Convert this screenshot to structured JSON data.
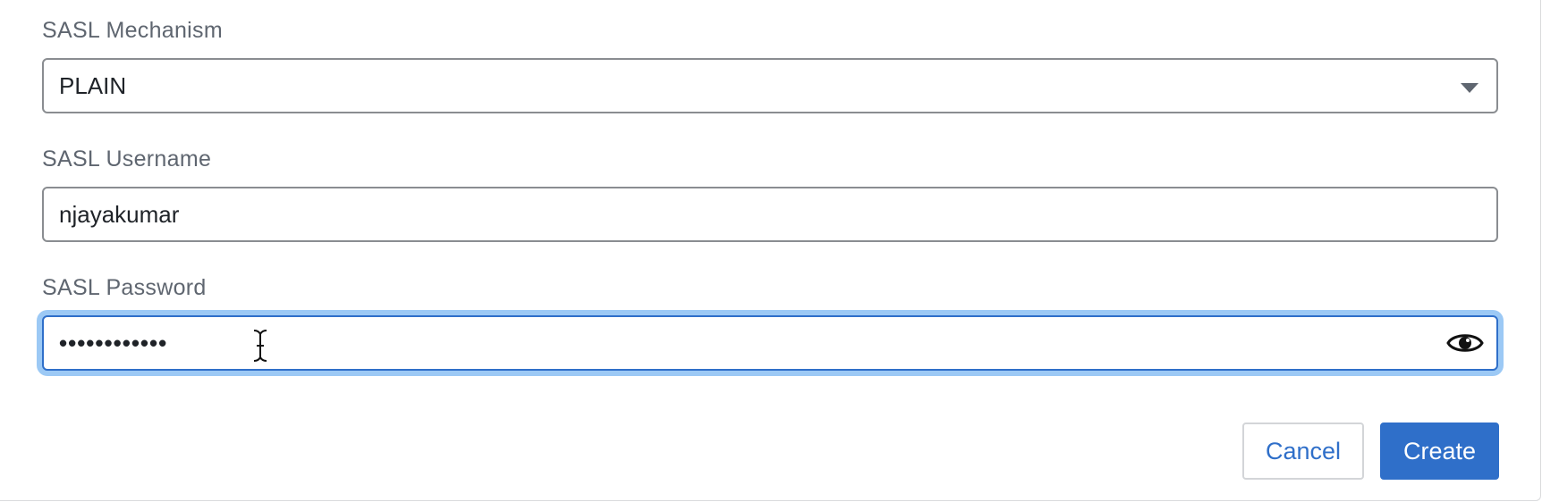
{
  "form": {
    "mechanism": {
      "label": "SASL Mechanism",
      "value": "PLAIN",
      "icon": "chevron-down-icon"
    },
    "username": {
      "label": "SASL Username",
      "value": "njayakumar"
    },
    "password": {
      "label": "SASL Password",
      "masked_value": "••••••••••••",
      "icon": "eye-icon"
    }
  },
  "actions": {
    "cancel_label": "Cancel",
    "create_label": "Create"
  },
  "colors": {
    "accent": "#2f6fc9",
    "focus_ring": "#9cc9f5",
    "label_text": "#5f6670",
    "field_border": "#8a8d91"
  }
}
